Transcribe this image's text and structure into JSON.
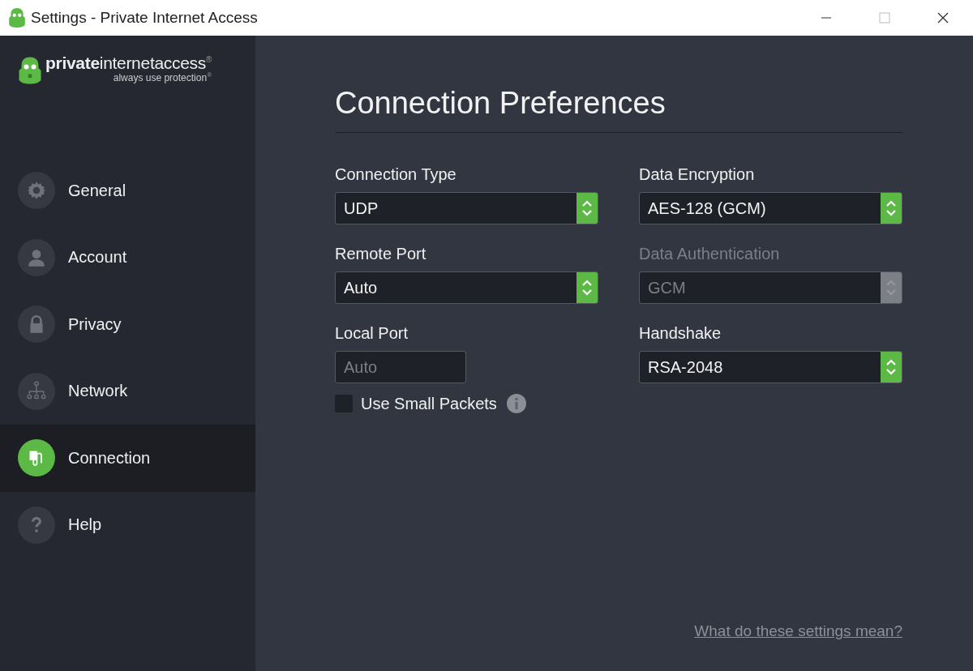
{
  "window": {
    "title": "Settings - Private Internet Access"
  },
  "logo": {
    "wordmark": "**private**internetaccess$^{®}$",
    "tagline": "always use protection$^{®}$"
  },
  "sidebar": {
    "items": [
      {
        "label": "General",
        "kind": "gear",
        "selected": false
      },
      {
        "label": "Account",
        "kind": "person",
        "selected": false
      },
      {
        "label": "Privacy",
        "kind": "lock",
        "selected": false
      },
      {
        "label": "Network",
        "kind": "network",
        "selected": false
      },
      {
        "label": "Connection",
        "kind": "plug",
        "selected": true
      },
      {
        "label": "Help",
        "kind": "question",
        "selected": false
      }
    ]
  },
  "page": {
    "heading": "Connection Preferences",
    "left_column": [
      {
        "label": "Connection Type",
        "kind": "select",
        "value": "UDP",
        "disabled": false
      },
      {
        "label": "Remote Port",
        "kind": "select",
        "value": "Auto",
        "disabled": false
      },
      {
        "label": "Local Port",
        "kind": "input",
        "placeholder": "Auto"
      }
    ],
    "right_column": [
      {
        "label": "Data Encryption",
        "kind": "select",
        "value": "AES-128 (GCM)",
        "disabled": false
      },
      {
        "label": "Data Authentication",
        "kind": "select",
        "value": "GCM",
        "disabled": true
      },
      {
        "label": "Handshake",
        "kind": "select",
        "value": "RSA-2048",
        "disabled": false
      }
    ],
    "checkbox": {
      "label": "Use Small Packets",
      "checked": false
    },
    "help_link": "What do these settings mean?"
  }
}
